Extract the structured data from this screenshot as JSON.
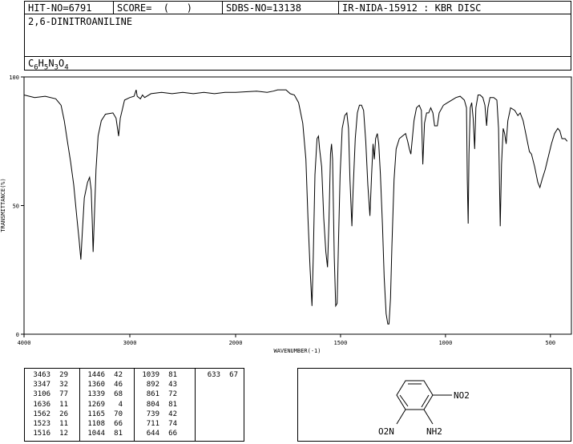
{
  "header": {
    "hit_no": "HIT-NO=6791",
    "score": "SCORE=  (   )",
    "sdbs_no": "SDBS-NO=13138",
    "ir_nida": "IR-NIDA-15912 : KBR DISC"
  },
  "compound_name": "2,6-DINITROANILINE",
  "formula": {
    "parts": [
      "C",
      "6",
      "H",
      "5",
      "N",
      "3",
      "O",
      "4"
    ]
  },
  "chart_data": {
    "type": "line",
    "xlabel": "WAVENUMBER(-1)",
    "ylabel": "TRANSMITTANCE(%)",
    "xlim": [
      4000,
      400
    ],
    "ylim": [
      0,
      100
    ],
    "x_ticks": [
      4000,
      3000,
      2000,
      1500,
      1000,
      500
    ],
    "y_ticks": [
      0,
      50,
      100
    ],
    "grid": false,
    "series": [
      {
        "points": [
          [
            4000,
            93
          ],
          [
            3900,
            92
          ],
          [
            3800,
            92.5
          ],
          [
            3700,
            91.5
          ],
          [
            3650,
            89
          ],
          [
            3620,
            83
          ],
          [
            3590,
            75
          ],
          [
            3560,
            67
          ],
          [
            3530,
            58
          ],
          [
            3500,
            45
          ],
          [
            3480,
            37
          ],
          [
            3463,
            29
          ],
          [
            3450,
            39
          ],
          [
            3430,
            53
          ],
          [
            3400,
            59
          ],
          [
            3380,
            61
          ],
          [
            3365,
            56
          ],
          [
            3355,
            44
          ],
          [
            3347,
            32
          ],
          [
            3335,
            46
          ],
          [
            3320,
            64
          ],
          [
            3300,
            77
          ],
          [
            3270,
            83
          ],
          [
            3230,
            85.5
          ],
          [
            3160,
            86
          ],
          [
            3130,
            84
          ],
          [
            3106,
            77
          ],
          [
            3090,
            84
          ],
          [
            3050,
            91
          ],
          [
            3000,
            92
          ],
          [
            2960,
            92.5
          ],
          [
            2940,
            95
          ],
          [
            2930,
            92.5
          ],
          [
            2900,
            91.5
          ],
          [
            2880,
            93
          ],
          [
            2860,
            92
          ],
          [
            2800,
            93.5
          ],
          [
            2700,
            94
          ],
          [
            2600,
            93.5
          ],
          [
            2500,
            94
          ],
          [
            2400,
            93.5
          ],
          [
            2300,
            94
          ],
          [
            2200,
            93.5
          ],
          [
            2100,
            94
          ],
          [
            2000,
            94
          ],
          [
            1900,
            94.5
          ],
          [
            1850,
            94
          ],
          [
            1820,
            94.5
          ],
          [
            1800,
            95
          ],
          [
            1760,
            95
          ],
          [
            1740,
            93.5
          ],
          [
            1720,
            93
          ],
          [
            1700,
            90
          ],
          [
            1680,
            82
          ],
          [
            1665,
            68
          ],
          [
            1655,
            45
          ],
          [
            1645,
            25
          ],
          [
            1636,
            11
          ],
          [
            1630,
            30
          ],
          [
            1622,
            62
          ],
          [
            1612,
            76
          ],
          [
            1605,
            77
          ],
          [
            1600,
            72
          ],
          [
            1590,
            65
          ],
          [
            1580,
            45
          ],
          [
            1570,
            32
          ],
          [
            1562,
            26
          ],
          [
            1555,
            44
          ],
          [
            1548,
            70
          ],
          [
            1543,
            74
          ],
          [
            1538,
            68
          ],
          [
            1530,
            30
          ],
          [
            1523,
            11
          ],
          [
            1516,
            12
          ],
          [
            1510,
            35
          ],
          [
            1502,
            62
          ],
          [
            1492,
            80
          ],
          [
            1480,
            85
          ],
          [
            1470,
            86
          ],
          [
            1462,
            80
          ],
          [
            1455,
            60
          ],
          [
            1446,
            42
          ],
          [
            1440,
            56
          ],
          [
            1430,
            76
          ],
          [
            1420,
            86
          ],
          [
            1410,
            89
          ],
          [
            1400,
            89
          ],
          [
            1390,
            87
          ],
          [
            1380,
            75
          ],
          [
            1370,
            58
          ],
          [
            1360,
            46
          ],
          [
            1352,
            62
          ],
          [
            1345,
            74
          ],
          [
            1339,
            68
          ],
          [
            1333,
            76
          ],
          [
            1325,
            78
          ],
          [
            1318,
            74
          ],
          [
            1310,
            62
          ],
          [
            1300,
            42
          ],
          [
            1292,
            22
          ],
          [
            1283,
            8
          ],
          [
            1275,
            4
          ],
          [
            1269,
            4
          ],
          [
            1262,
            14
          ],
          [
            1255,
            35
          ],
          [
            1245,
            60
          ],
          [
            1235,
            72
          ],
          [
            1220,
            76
          ],
          [
            1205,
            77
          ],
          [
            1190,
            78
          ],
          [
            1180,
            75
          ],
          [
            1172,
            72
          ],
          [
            1165,
            70
          ],
          [
            1158,
            76
          ],
          [
            1150,
            83
          ],
          [
            1138,
            88
          ],
          [
            1125,
            89
          ],
          [
            1115,
            87
          ],
          [
            1108,
            66
          ],
          [
            1100,
            82
          ],
          [
            1090,
            86
          ],
          [
            1080,
            86
          ],
          [
            1070,
            88
          ],
          [
            1060,
            86
          ],
          [
            1052,
            81
          ],
          [
            1044,
            81
          ],
          [
            1039,
            81
          ],
          [
            1030,
            86
          ],
          [
            1010,
            89
          ],
          [
            990,
            90
          ],
          [
            970,
            91
          ],
          [
            950,
            92
          ],
          [
            930,
            92.5
          ],
          [
            910,
            91
          ],
          [
            900,
            88
          ],
          [
            896,
            60
          ],
          [
            892,
            43
          ],
          [
            888,
            70
          ],
          [
            882,
            88
          ],
          [
            875,
            90
          ],
          [
            868,
            84
          ],
          [
            861,
            72
          ],
          [
            855,
            88
          ],
          [
            845,
            93
          ],
          [
            835,
            93
          ],
          [
            822,
            92
          ],
          [
            812,
            89
          ],
          [
            804,
            81
          ],
          [
            798,
            88
          ],
          [
            788,
            92
          ],
          [
            770,
            92
          ],
          [
            755,
            91
          ],
          [
            747,
            80
          ],
          [
            739,
            42
          ],
          [
            733,
            66
          ],
          [
            725,
            80
          ],
          [
            718,
            78
          ],
          [
            711,
            74
          ],
          [
            703,
            83
          ],
          [
            690,
            88
          ],
          [
            670,
            87
          ],
          [
            655,
            85
          ],
          [
            644,
            86
          ],
          [
            630,
            83
          ],
          [
            615,
            77
          ],
          [
            600,
            71
          ],
          [
            590,
            70
          ],
          [
            575,
            65
          ],
          [
            560,
            59
          ],
          [
            550,
            57
          ],
          [
            540,
            60
          ],
          [
            525,
            64
          ],
          [
            510,
            69
          ],
          [
            495,
            74
          ],
          [
            480,
            78
          ],
          [
            465,
            80
          ],
          [
            455,
            79
          ],
          [
            445,
            76
          ],
          [
            430,
            76
          ],
          [
            420,
            75
          ]
        ]
      }
    ]
  },
  "peak_table": [
    [
      [
        "3463",
        "29"
      ],
      [
        "3347",
        "32"
      ],
      [
        "3106",
        "77"
      ],
      [
        "1636",
        "11"
      ],
      [
        "1562",
        "26"
      ],
      [
        "1523",
        "11"
      ],
      [
        "1516",
        "12"
      ]
    ],
    [
      [
        "1446",
        "42"
      ],
      [
        "1360",
        "46"
      ],
      [
        "1339",
        "68"
      ],
      [
        "1269",
        "4"
      ],
      [
        "1165",
        "70"
      ],
      [
        "1108",
        "66"
      ],
      [
        "1044",
        "81"
      ]
    ],
    [
      [
        "1039",
        "81"
      ],
      [
        "892",
        "43"
      ],
      [
        "861",
        "72"
      ],
      [
        "804",
        "81"
      ],
      [
        "739",
        "42"
      ],
      [
        "711",
        "74"
      ],
      [
        "644",
        "66"
      ]
    ],
    [
      [
        "633",
        "67"
      ]
    ]
  ],
  "structure": {
    "substituent_top": "NO2",
    "substituent_bottom_left": "O2N",
    "substituent_bottom_right": "NH2"
  }
}
